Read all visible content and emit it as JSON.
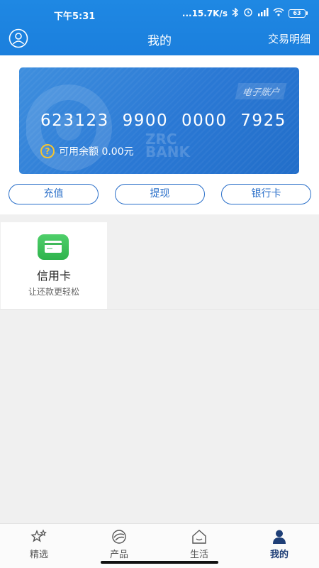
{
  "status_bar": {
    "time": "下午5:31",
    "network_speed": "...15.7K/s",
    "battery": "63"
  },
  "nav": {
    "title": "我的",
    "right_link": "交易明细",
    "user_icon": "user-circle-icon"
  },
  "card": {
    "tag": "电子账户",
    "number": "623123 9900 0000 7925",
    "balance_label": "可用余额 0.00元",
    "help_icon": "?",
    "watermark": [
      "ZRC",
      "BANK"
    ]
  },
  "actions": [
    {
      "label": "充值"
    },
    {
      "label": "提现"
    },
    {
      "label": "银行卡"
    }
  ],
  "services": [
    {
      "title": "信用卡",
      "subtitle": "让还款更轻松",
      "icon": "credit-card-icon"
    }
  ],
  "tabs": [
    {
      "label": "精选",
      "icon": "stars-icon",
      "active": false
    },
    {
      "label": "产品",
      "icon": "product-icon",
      "active": false
    },
    {
      "label": "生活",
      "icon": "home-icon",
      "active": false
    },
    {
      "label": "我的",
      "icon": "person-icon",
      "active": true
    }
  ],
  "colors": {
    "header": "#1f88e3",
    "card": "#2a78d4",
    "accent": "#2a6fc9",
    "active_tab": "#1f3f77",
    "service_icon": "#3fc15c"
  }
}
